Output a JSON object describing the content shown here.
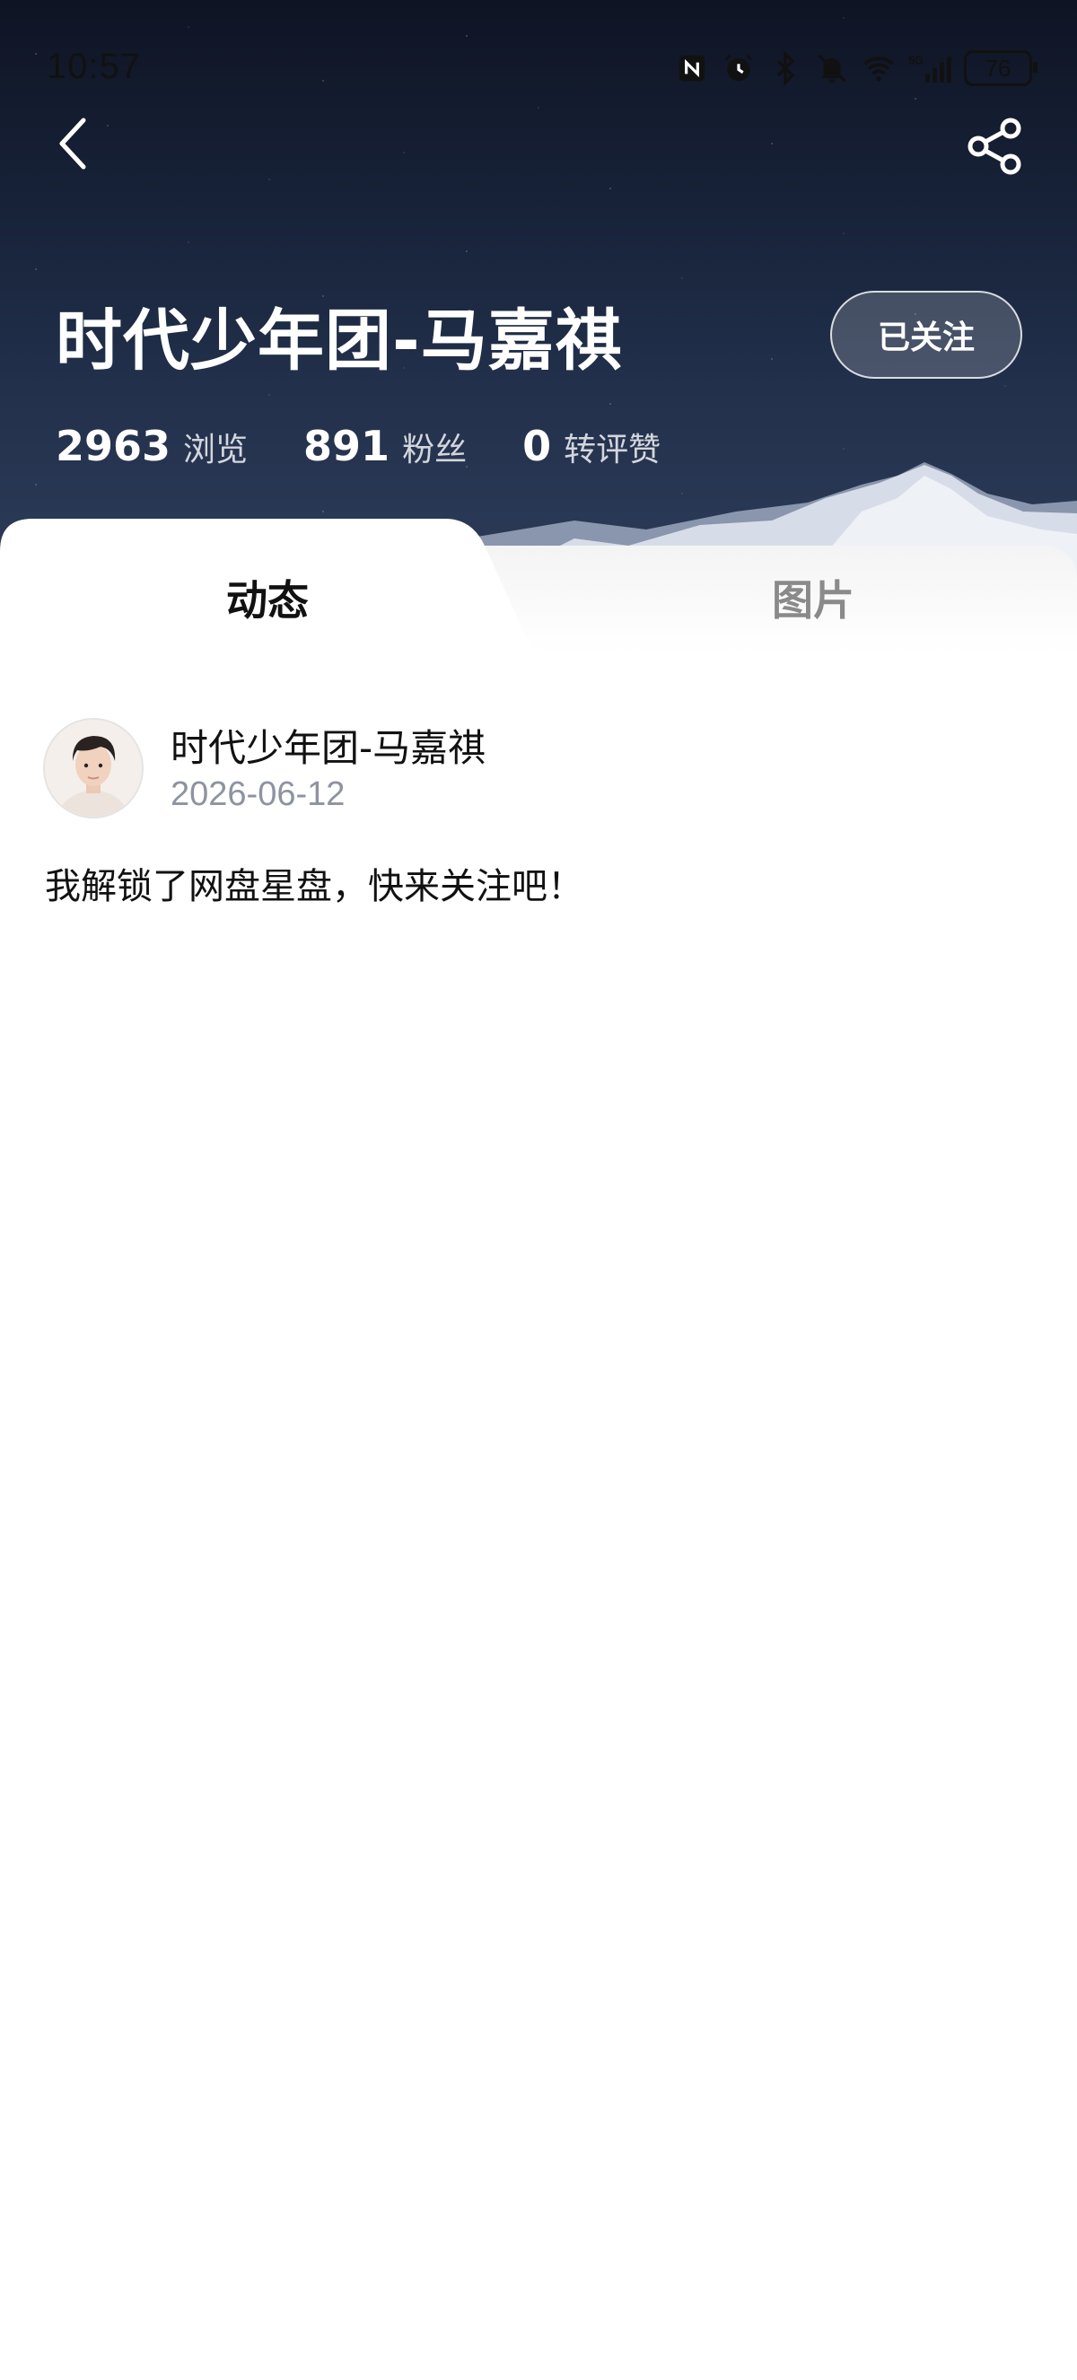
{
  "status_bar": {
    "time": "10:57",
    "battery": "76",
    "icons": [
      "nfc-icon",
      "alarm-icon",
      "bluetooth-icon",
      "mute-icon",
      "wifi-icon",
      "signal-5g-icon",
      "battery-icon"
    ],
    "network_label": "5G"
  },
  "header": {
    "title": "时代少年团-马嘉祺",
    "follow_label": "已关注",
    "back_icon": "back-arrow-icon",
    "share_icon": "share-icon"
  },
  "stats": [
    {
      "value": "2963",
      "label": "浏览"
    },
    {
      "value": "891",
      "label": "粉丝"
    },
    {
      "value": "0",
      "label": "转评赞"
    }
  ],
  "tabs": [
    {
      "label": "动态",
      "active": true
    },
    {
      "label": "图片",
      "active": false
    }
  ],
  "post": {
    "author": "时代少年团-马嘉祺",
    "date": "2026-06-12",
    "text": "我解锁了网盘星盘，快来关注吧！"
  },
  "colors": {
    "hero_top": "#0f1424",
    "hero_bottom": "#2c3b57",
    "date_gray": "#8d93a0",
    "tab_inactive": "#8a8a8a"
  }
}
